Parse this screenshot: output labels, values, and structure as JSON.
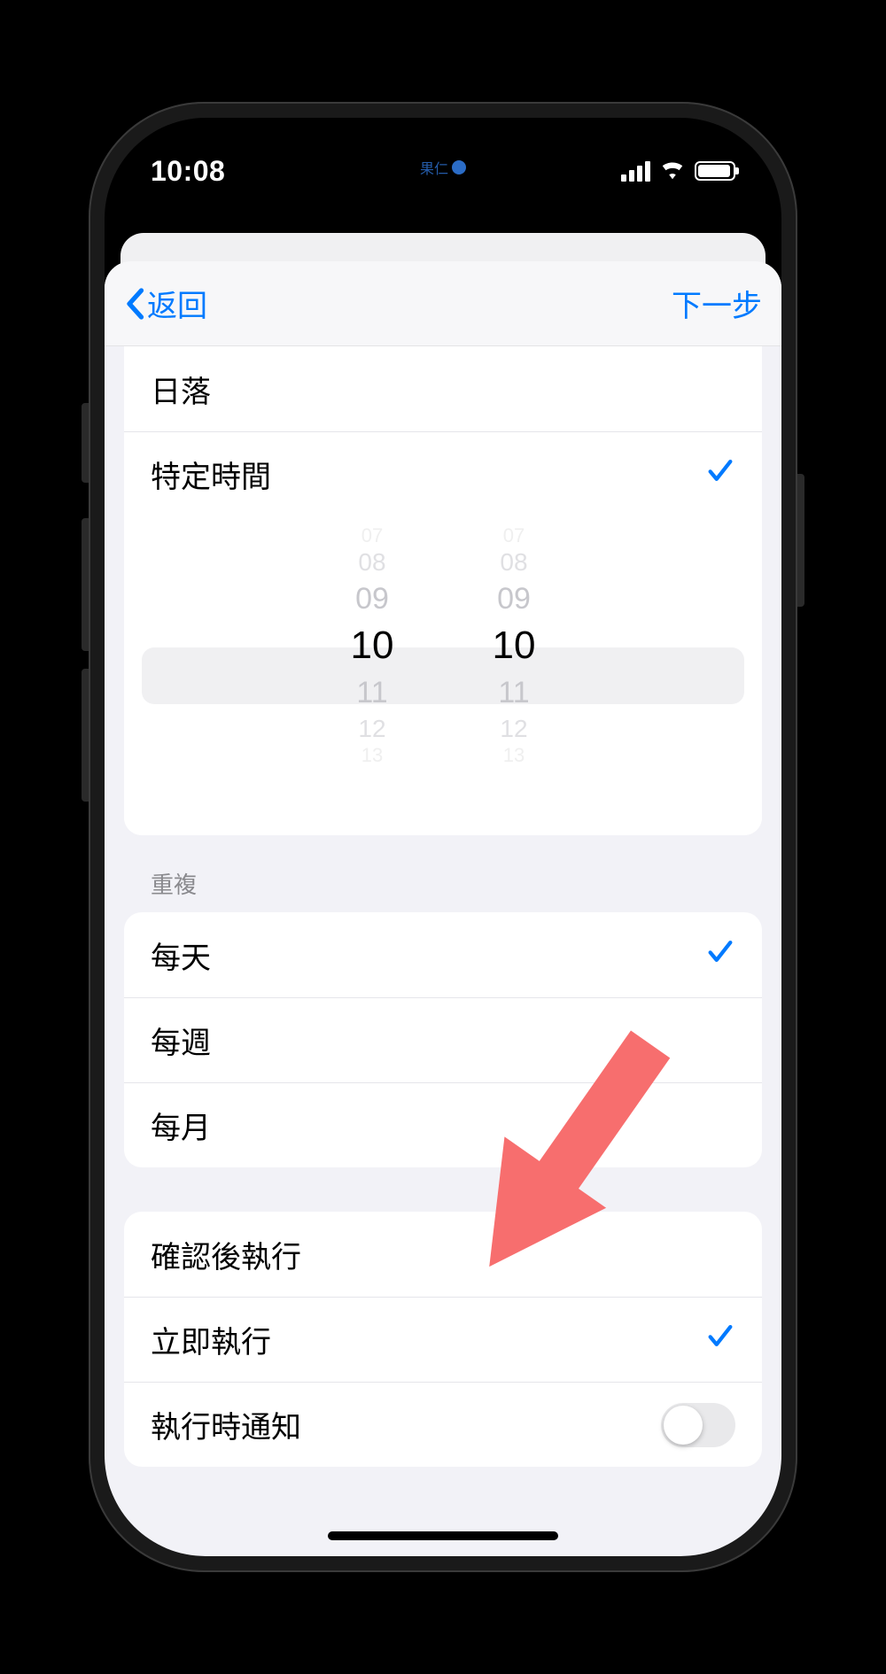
{
  "status": {
    "time": "10:08",
    "island_text": "果仁"
  },
  "nav": {
    "back": "返回",
    "next": "下一步"
  },
  "time_options": {
    "sunset": "日落",
    "specific": "特定時間"
  },
  "picker": {
    "hour_minus3": "07",
    "hour_minus2": "08",
    "hour_minus1": "09",
    "hour_sel": "10",
    "hour_plus1": "11",
    "hour_plus2": "12",
    "hour_plus3": "13",
    "min_minus3": "07",
    "min_minus2": "08",
    "min_minus1": "09",
    "min_sel": "10",
    "min_plus1": "11",
    "min_plus2": "12",
    "min_plus3": "13"
  },
  "repeat": {
    "header": "重複",
    "daily": "每天",
    "weekly": "每週",
    "monthly": "每月"
  },
  "run": {
    "confirm": "確認後執行",
    "immediate": "立即執行",
    "notify": "執行時通知"
  }
}
